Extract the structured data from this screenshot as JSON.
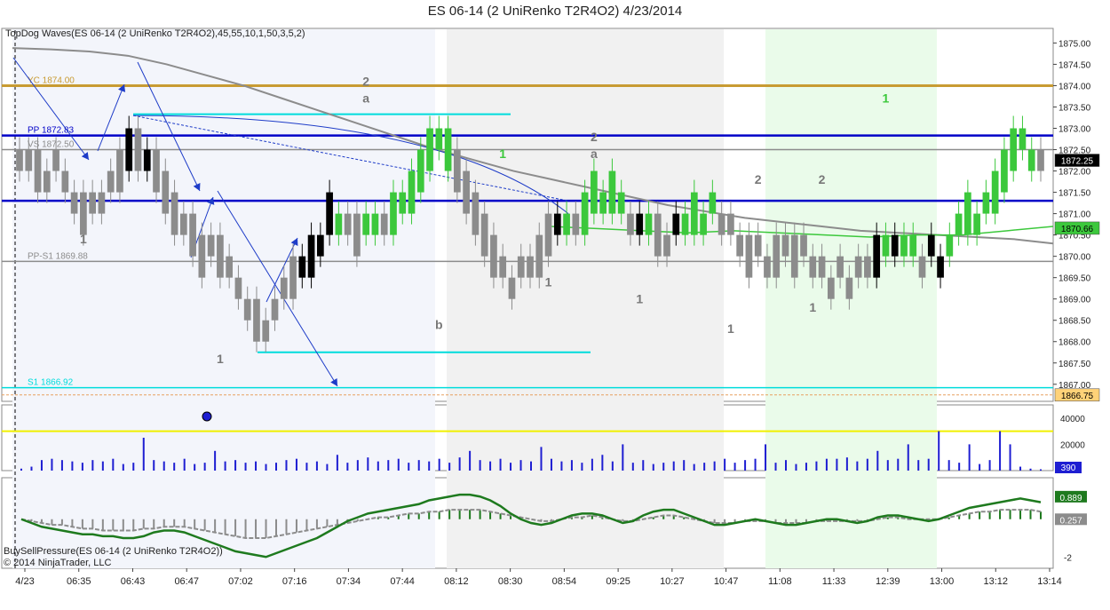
{
  "title": "ES 06-14 (2 UniRenko T2R4O2)  4/23/2014",
  "indicator_label": "TopDog Waves(ES 06-14 (2 UniRenko T2R4O2),45,55,10,1,50,3,5,2)",
  "lower_label": "BuySellPressure(ES 06-14 (2 UniRenko T2R4O2))",
  "copyright": "© 2014 NinjaTrader, LLC",
  "colors": {
    "up_bar": "#3cc83c",
    "down_bar": "#8c8c8c",
    "dark_bar": "#000000",
    "pivot_line": "#0000c8",
    "cyan_line": "#00dcdc",
    "yc_line": "#c89b32",
    "gray_ma": "#8c8c8c",
    "green_ma": "#3cc83c",
    "volume": "#1e1ed2",
    "threshold": "#f0f000"
  },
  "chart_data": [
    {
      "type": "bar",
      "title": "ES 06-14 (2 UniRenko T2R4O2)  4/23/2014",
      "x_tick_labels": [
        "4/23",
        "06:35",
        "06:43",
        "06:47",
        "07:02",
        "07:16",
        "07:34",
        "07:44",
        "08:12",
        "08:30",
        "08:54",
        "09:25",
        "10:27",
        "10:47",
        "11:08",
        "11:33",
        "12:39",
        "13:00",
        "13:12",
        "13:14"
      ],
      "y_tick_labels": [
        "1875.00",
        "1874.50",
        "1874.00",
        "1873.50",
        "1873.00",
        "1872.50",
        "1872.00",
        "1871.50",
        "1871.00",
        "1870.50",
        "1870.00",
        "1869.50",
        "1869.00",
        "1868.50",
        "1868.00",
        "1867.50",
        "1867.00"
      ],
      "ylim": [
        1866.6,
        1875.3
      ],
      "bars": [
        [
          1872.5,
          1872.0,
          "g"
        ],
        [
          1872.5,
          1872.0,
          "g"
        ],
        [
          1872.5,
          1871.5,
          "g"
        ],
        [
          1872.0,
          1871.5,
          "g"
        ],
        [
          1872.5,
          1872.0,
          "g"
        ],
        [
          1872.0,
          1871.5,
          "g"
        ],
        [
          1871.5,
          1871.0,
          "g"
        ],
        [
          1871.5,
          1870.5,
          "g"
        ],
        [
          1871.5,
          1871.0,
          "g"
        ],
        [
          1871.5,
          1871.0,
          "g"
        ],
        [
          1872.0,
          1871.5,
          "g"
        ],
        [
          1872.5,
          1871.5,
          "g"
        ],
        [
          1873.0,
          1872.0,
          "k"
        ],
        [
          1873.0,
          1872.0,
          "g"
        ],
        [
          1872.5,
          1872.0,
          "k"
        ],
        [
          1872.5,
          1871.5,
          "g"
        ],
        [
          1872.0,
          1871.0,
          "g"
        ],
        [
          1871.5,
          1870.5,
          "g"
        ],
        [
          1871.0,
          1870.5,
          "g"
        ],
        [
          1871.0,
          1870.0,
          "g"
        ],
        [
          1870.5,
          1869.5,
          "g"
        ],
        [
          1870.5,
          1870.0,
          "g"
        ],
        [
          1870.5,
          1869.5,
          "g"
        ],
        [
          1870.0,
          1869.5,
          "g"
        ],
        [
          1869.5,
          1869.0,
          "g"
        ],
        [
          1869.0,
          1868.5,
          "g"
        ],
        [
          1869.0,
          1868.0,
          "g"
        ],
        [
          1868.5,
          1868.0,
          "g"
        ],
        [
          1869.0,
          1868.5,
          "g"
        ],
        [
          1869.5,
          1869.0,
          "g"
        ],
        [
          1870.0,
          1869.0,
          "g"
        ],
        [
          1870.0,
          1869.5,
          "k"
        ],
        [
          1870.5,
          1869.5,
          "k"
        ],
        [
          1870.5,
          1870.0,
          "k"
        ],
        [
          1871.5,
          1870.5,
          "k"
        ],
        [
          1871.0,
          1870.5,
          "u"
        ],
        [
          1871.0,
          1870.5,
          "g"
        ],
        [
          1871.0,
          1870.0,
          "g"
        ],
        [
          1871.0,
          1870.5,
          "u"
        ],
        [
          1871.0,
          1870.5,
          "u"
        ],
        [
          1871.0,
          1870.5,
          "g"
        ],
        [
          1871.5,
          1870.5,
          "u"
        ],
        [
          1871.5,
          1871.0,
          "u"
        ],
        [
          1872.0,
          1871.0,
          "u"
        ],
        [
          1872.5,
          1871.5,
          "u"
        ],
        [
          1873.0,
          1872.0,
          "u"
        ],
        [
          1873.0,
          1872.5,
          "u"
        ],
        [
          1873.0,
          1872.0,
          "u"
        ],
        [
          1872.5,
          1871.5,
          "g"
        ],
        [
          1872.0,
          1871.0,
          "g"
        ],
        [
          1871.5,
          1870.5,
          "g"
        ],
        [
          1871.0,
          1870.0,
          "g"
        ],
        [
          1870.5,
          1869.5,
          "g"
        ],
        [
          1870.0,
          1869.5,
          "g"
        ],
        [
          1869.5,
          1869.0,
          "g"
        ],
        [
          1870.0,
          1869.5,
          "g"
        ],
        [
          1870.0,
          1869.5,
          "g"
        ],
        [
          1870.5,
          1869.5,
          "g"
        ],
        [
          1871.0,
          1870.0,
          "g"
        ],
        [
          1871.0,
          1870.5,
          "k"
        ],
        [
          1871.0,
          1870.5,
          "u"
        ],
        [
          1871.0,
          1870.5,
          "g"
        ],
        [
          1871.5,
          1870.5,
          "u"
        ],
        [
          1872.0,
          1871.0,
          "u"
        ],
        [
          1871.5,
          1871.0,
          "u"
        ],
        [
          1872.0,
          1871.0,
          "u"
        ],
        [
          1871.5,
          1871.0,
          "u"
        ],
        [
          1871.0,
          1870.5,
          "g"
        ],
        [
          1871.0,
          1870.5,
          "k"
        ],
        [
          1871.0,
          1870.5,
          "u"
        ],
        [
          1871.0,
          1870.0,
          "g"
        ],
        [
          1870.5,
          1870.0,
          "g"
        ],
        [
          1871.0,
          1870.5,
          "k"
        ],
        [
          1871.0,
          1870.5,
          "u"
        ],
        [
          1871.5,
          1870.5,
          "u"
        ],
        [
          1871.0,
          1870.5,
          "u"
        ],
        [
          1871.5,
          1871.0,
          "u"
        ],
        [
          1871.0,
          1870.5,
          "g"
        ],
        [
          1871.0,
          1870.5,
          "g"
        ],
        [
          1870.5,
          1870.0,
          "g"
        ],
        [
          1870.5,
          1869.5,
          "g"
        ],
        [
          1870.5,
          1870.0,
          "g"
        ],
        [
          1870.0,
          1869.5,
          "g"
        ],
        [
          1870.5,
          1869.5,
          "g"
        ],
        [
          1870.5,
          1870.0,
          "g"
        ],
        [
          1870.5,
          1869.5,
          "g"
        ],
        [
          1870.5,
          1870.0,
          "g"
        ],
        [
          1870.0,
          1869.5,
          "g"
        ],
        [
          1870.0,
          1869.5,
          "g"
        ],
        [
          1869.5,
          1869.0,
          "g"
        ],
        [
          1870.0,
          1869.5,
          "g"
        ],
        [
          1869.5,
          1869.0,
          "g"
        ],
        [
          1870.0,
          1869.5,
          "g"
        ],
        [
          1870.0,
          1869.5,
          "g"
        ],
        [
          1870.5,
          1869.5,
          "k"
        ],
        [
          1870.5,
          1870.0,
          "u"
        ],
        [
          1870.5,
          1870.0,
          "k"
        ],
        [
          1870.5,
          1870.0,
          "u"
        ],
        [
          1870.5,
          1870.0,
          "u"
        ],
        [
          1870.0,
          1869.5,
          "g"
        ],
        [
          1870.5,
          1870.0,
          "k"
        ],
        [
          1870.0,
          1869.5,
          "k"
        ],
        [
          1870.5,
          1870.0,
          "u"
        ],
        [
          1871.0,
          1870.5,
          "u"
        ],
        [
          1871.5,
          1870.5,
          "u"
        ],
        [
          1871.0,
          1870.5,
          "u"
        ],
        [
          1871.5,
          1871.0,
          "u"
        ],
        [
          1872.0,
          1871.0,
          "u"
        ],
        [
          1872.5,
          1871.5,
          "u"
        ],
        [
          1873.0,
          1872.0,
          "u"
        ],
        [
          1873.0,
          1872.5,
          "u"
        ],
        [
          1872.5,
          1872.0,
          "u"
        ],
        [
          1872.5,
          1872.0,
          "g"
        ]
      ],
      "horizontal_lines": [
        {
          "label": "YC 1874.00",
          "value": 1874.0,
          "color": "#c89b32"
        },
        {
          "label": "PP 1872.83",
          "value": 1872.83,
          "color": "#0000c8"
        },
        {
          "label": "VS 1872.50",
          "value": 1872.5,
          "color": "#8c8c8c"
        },
        {
          "label": "PP-S1 1869.88",
          "value": 1869.88,
          "color": "#8c8c8c"
        },
        {
          "label": "S1 1866.92",
          "value": 1866.92,
          "color": "#00dcdc"
        }
      ],
      "price_markers": [
        {
          "value": 1872.25,
          "text": "1872.25",
          "bg": "#000000",
          "fg": "#ffffff"
        },
        {
          "value": 1870.66,
          "text": "1870.66",
          "bg": "#3cc83c",
          "fg": "#000000"
        },
        {
          "value": 1866.75,
          "text": "1866.75",
          "bg": "#ffd278",
          "fg": "#000000"
        }
      ],
      "wave_labels": [
        {
          "text": "1",
          "bar": 7,
          "value": 1870.3,
          "color": "#787878"
        },
        {
          "text": "1",
          "bar": 22,
          "value": 1867.5,
          "color": "#787878"
        },
        {
          "text": "2",
          "bar": 38,
          "value": 1874.0,
          "color": "#787878"
        },
        {
          "text": "a",
          "bar": 38,
          "value": 1873.6,
          "color": "#787878"
        },
        {
          "text": "b",
          "bar": 46,
          "value": 1868.3,
          "color": "#787878"
        },
        {
          "text": "1",
          "bar": 53,
          "value": 1872.3,
          "color": "#3cc83c"
        },
        {
          "text": "1",
          "bar": 58,
          "value": 1869.3,
          "color": "#787878"
        },
        {
          "text": "2",
          "bar": 63,
          "value": 1872.7,
          "color": "#787878"
        },
        {
          "text": "a",
          "bar": 63,
          "value": 1872.3,
          "color": "#787878"
        },
        {
          "text": "1",
          "bar": 68,
          "value": 1868.9,
          "color": "#787878"
        },
        {
          "text": "1",
          "bar": 78,
          "value": 1868.2,
          "color": "#787878"
        },
        {
          "text": "2",
          "bar": 81,
          "value": 1871.7,
          "color": "#787878"
        },
        {
          "text": "2",
          "bar": 88,
          "value": 1871.7,
          "color": "#787878"
        },
        {
          "text": "1",
          "bar": 87,
          "value": 1868.7,
          "color": "#787878"
        },
        {
          "text": "1",
          "bar": 95,
          "value": 1873.6,
          "color": "#3cc83c"
        }
      ],
      "gray_ma": [
        1874.88,
        1874.85,
        1874.8,
        1874.7,
        1874.5,
        1874.25,
        1874.0,
        1873.7,
        1873.4,
        1873.1,
        1872.8,
        1872.5,
        1872.25,
        1872.0,
        1871.8,
        1871.6,
        1871.4,
        1871.2,
        1871.05,
        1870.9,
        1870.8,
        1870.7,
        1870.6,
        1870.55,
        1870.5,
        1870.45,
        1870.4,
        1870.3
      ],
      "green_ma": [
        1870.7,
        1870.65,
        1870.6,
        1870.55,
        1870.6,
        1870.55,
        1870.5,
        1870.45,
        1870.5,
        1870.5,
        1870.6,
        1870.7
      ],
      "cyan_levels": [
        1873.33,
        1867.75
      ],
      "annotations": [
        "TopDog Waves(ES 06-14 (2 UniRenko T2R4O2),45,55,10,1,50,3,5,2)"
      ]
    },
    {
      "type": "bar",
      "title": "Volume",
      "y_tick_labels": [
        "40000",
        "20000"
      ],
      "ylim": [
        0,
        50000
      ],
      "threshold": 30000,
      "last_value_label": "390",
      "values": [
        1500,
        3000,
        8000,
        9000,
        8000,
        7000,
        6000,
        8000,
        7000,
        9000,
        5000,
        6000,
        25000,
        8000,
        7000,
        6000,
        9000,
        5000,
        6000,
        15000,
        7000,
        8000,
        6000,
        7000,
        5000,
        6000,
        8000,
        9000,
        6000,
        7000,
        5000,
        12000,
        6000,
        8000,
        10000,
        7000,
        8000,
        9000,
        6000,
        8000,
        7000,
        9000,
        6000,
        10000,
        15000,
        8000,
        7000,
        9000,
        6000,
        8000,
        7000,
        18000,
        9000,
        7000,
        8000,
        6000,
        9000,
        12000,
        7000,
        20000,
        6000,
        8000,
        5000,
        6000,
        7000,
        8000,
        5000,
        6000,
        7000,
        9000,
        6000,
        8000,
        9000,
        20000,
        6000,
        8000,
        5000,
        6000,
        7000,
        9000,
        9000,
        10000,
        7000,
        9000,
        15000,
        8000,
        9000,
        20000,
        8000,
        9000,
        30000,
        8000,
        6000,
        20000,
        5000,
        8000,
        30000,
        20000,
        3000,
        1500,
        1000
      ]
    },
    {
      "type": "line",
      "title": "BuySellPressure(ES 06-14 (2 UniRenko T2R4O2))",
      "y_tick_labels": [
        "0",
        "-2"
      ],
      "ylim": [
        -2.6,
        2.2
      ],
      "value_labels": [
        "0.889",
        "0.257"
      ],
      "green": [
        0.0,
        -0.2,
        -0.4,
        -0.5,
        -0.6,
        -0.7,
        -0.8,
        -0.8,
        -0.9,
        -0.9,
        -1.0,
        -1.0,
        -0.9,
        -0.7,
        -0.6,
        -0.6,
        -0.7,
        -0.9,
        -1.1,
        -1.3,
        -1.5,
        -1.7,
        -1.8,
        -1.9,
        -2.0,
        -1.8,
        -1.6,
        -1.4,
        -1.2,
        -1.0,
        -0.7,
        -0.4,
        -0.1,
        0.1,
        0.3,
        0.4,
        0.5,
        0.6,
        0.7,
        0.8,
        1.0,
        1.1,
        1.2,
        1.3,
        1.3,
        1.2,
        1.0,
        0.7,
        0.3,
        0.0,
        -0.2,
        -0.3,
        -0.2,
        0.0,
        0.2,
        0.3,
        0.3,
        0.2,
        0.0,
        -0.2,
        -0.1,
        0.2,
        0.4,
        0.5,
        0.5,
        0.3,
        0.1,
        -0.1,
        -0.3,
        -0.3,
        -0.2,
        -0.1,
        0.0,
        -0.1,
        -0.2,
        -0.3,
        -0.3,
        -0.2,
        -0.1,
        0.0,
        0.0,
        -0.1,
        -0.2,
        -0.1,
        0.1,
        0.2,
        0.2,
        0.1,
        0.0,
        -0.1,
        0.0,
        0.2,
        0.4,
        0.6,
        0.7,
        0.8,
        0.9,
        1.0,
        1.1,
        1.0,
        0.9
      ],
      "gray": [
        0.0,
        -0.1,
        -0.2,
        -0.3,
        -0.3,
        -0.4,
        -0.5,
        -0.5,
        -0.6,
        -0.6,
        -0.6,
        -0.6,
        -0.5,
        -0.5,
        -0.4,
        -0.4,
        -0.4,
        -0.5,
        -0.6,
        -0.7,
        -0.8,
        -0.9,
        -1.0,
        -1.0,
        -1.0,
        -0.9,
        -0.8,
        -0.7,
        -0.6,
        -0.5,
        -0.4,
        -0.3,
        -0.2,
        -0.1,
        0.0,
        0.1,
        0.1,
        0.2,
        0.3,
        0.3,
        0.4,
        0.4,
        0.5,
        0.5,
        0.5,
        0.5,
        0.4,
        0.3,
        0.2,
        0.1,
        0.0,
        -0.1,
        -0.1,
        0.0,
        0.1,
        0.1,
        0.2,
        0.1,
        0.0,
        -0.1,
        -0.1,
        0.0,
        0.1,
        0.2,
        0.2,
        0.1,
        0.0,
        -0.1,
        -0.2,
        -0.2,
        -0.2,
        -0.1,
        -0.1,
        -0.1,
        -0.2,
        -0.2,
        -0.2,
        -0.2,
        -0.1,
        -0.1,
        -0.1,
        -0.1,
        -0.1,
        -0.1,
        0.0,
        0.1,
        0.1,
        0.0,
        0.0,
        0.0,
        0.0,
        0.1,
        0.2,
        0.3,
        0.4,
        0.4,
        0.5,
        0.5,
        0.5,
        0.5,
        0.4
      ]
    }
  ]
}
